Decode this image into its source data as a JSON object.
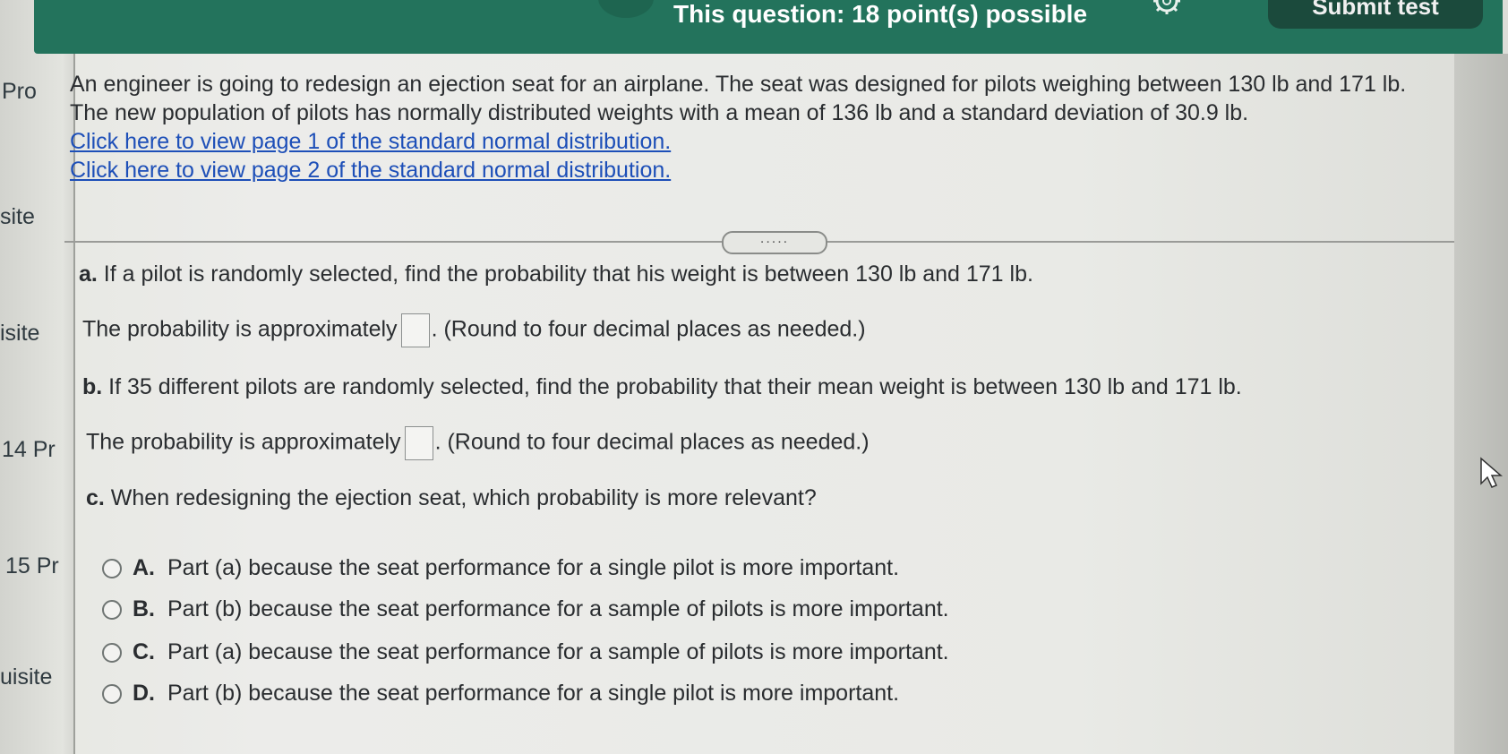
{
  "header": {
    "title": "This question: 18 point(s) possible",
    "submit_label": "Submit test"
  },
  "sidebar": {
    "items": [
      {
        "label": "Pro"
      },
      {
        "label": "site"
      },
      {
        "label": "isite"
      },
      {
        "label": "14 Pr"
      },
      {
        "label": "15 Pr"
      },
      {
        "label": "uisite"
      }
    ]
  },
  "question": {
    "intro_line1": "An engineer is going to redesign an ejection seat for an airplane. The seat was designed for pilots weighing between 130 lb and 171 lb.",
    "intro_line2": "The new population of pilots has normally distributed weights with a mean of 136 lb and a standard deviation of 30.9 lb.",
    "link1": "Click here to view page 1 of the standard normal distribution.",
    "link2": "Click here to view page 2 of the standard normal distribution.",
    "expand_label": ".....",
    "part_a": {
      "letter": "a.",
      "text": " If a pilot is randomly selected, find the probability that his weight is between 130 lb and 171 lb."
    },
    "answer_a": {
      "prefix": "The probability is approximately",
      "suffix": ". (Round to four decimal places as needed.)"
    },
    "part_b": {
      "letter": "b.",
      "text": " If 35 different pilots are randomly selected, find the probability that their mean weight  is between 130 lb and 171 lb."
    },
    "answer_b": {
      "prefix": "The probability is approximately",
      "suffix": ". (Round to four decimal places as needed.)"
    },
    "part_c": {
      "letter": "c.",
      "text": " When redesigning the ejection seat, which probability is more relevant?"
    },
    "options": [
      {
        "letter": "A.",
        "text": "Part (a) because the seat performance for a single pilot is more important."
      },
      {
        "letter": "B.",
        "text": "Part (b) because the seat performance for a sample of pilots is more important."
      },
      {
        "letter": "C.",
        "text": "Part (a) because the seat performance for a sample of pilots is more important."
      },
      {
        "letter": "D.",
        "text": "Part (b) because the seat performance for a single pilot is more important."
      }
    ]
  },
  "icons": {
    "gear": "gear-icon",
    "cursor": "cursor-arrow-icon"
  },
  "colors": {
    "header_bg": "#23735c",
    "link": "#1d4fb8",
    "text": "#2a2d30"
  }
}
